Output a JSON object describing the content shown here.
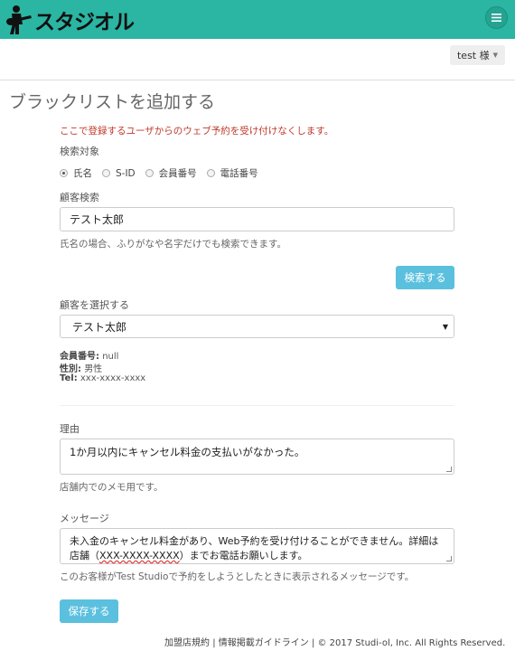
{
  "header": {
    "logo_text": "スタジオル",
    "menu_icon": "hamburger-icon",
    "brand_color": "#2bb5a3"
  },
  "user": {
    "label": "test 様"
  },
  "page": {
    "title": "ブラックリストを追加する",
    "notice": "ここで登録するユーザからのウェブ予約を受け付けなくします。"
  },
  "search_target": {
    "label": "検索対象",
    "options": [
      "氏名",
      "S-ID",
      "会員番号",
      "電話番号"
    ],
    "selected": "氏名"
  },
  "customer_search": {
    "label": "顧客検索",
    "value": "テスト太郎",
    "help": "氏名の場合、ふりがなや名字だけでも検索できます。",
    "button": "検索する"
  },
  "customer_select": {
    "label": "顧客を選択する",
    "value": "テスト太郎",
    "member_no_label": "会員番号:",
    "member_no": "null",
    "gender_label": "性別:",
    "gender": "男性",
    "tel_label": "Tel:",
    "tel": "xxx-xxxx-xxxx"
  },
  "reason": {
    "label": "理由",
    "value": "1か月以内にキャンセル料金の支払いがなかった。",
    "help": "店舗内でのメモ用です。"
  },
  "message": {
    "label": "メッセージ",
    "line1": "未入金のキャンセル料金があり、Web予約を受け付けることができません。詳細は",
    "line2_a": "店舗（",
    "line2_b": "XXX-XXXX-XXXX",
    "line2_c": "）までお電話お願いします。",
    "help": "このお客様がTest Studioで予約をしようとしたときに表示されるメッセージです。"
  },
  "save_button": "保存する",
  "footer": {
    "terms": "加盟店規約",
    "guideline": "情報掲載ガイドライン",
    "copyright": "© 2017 Studi-ol, Inc. All Rights Reserved."
  }
}
